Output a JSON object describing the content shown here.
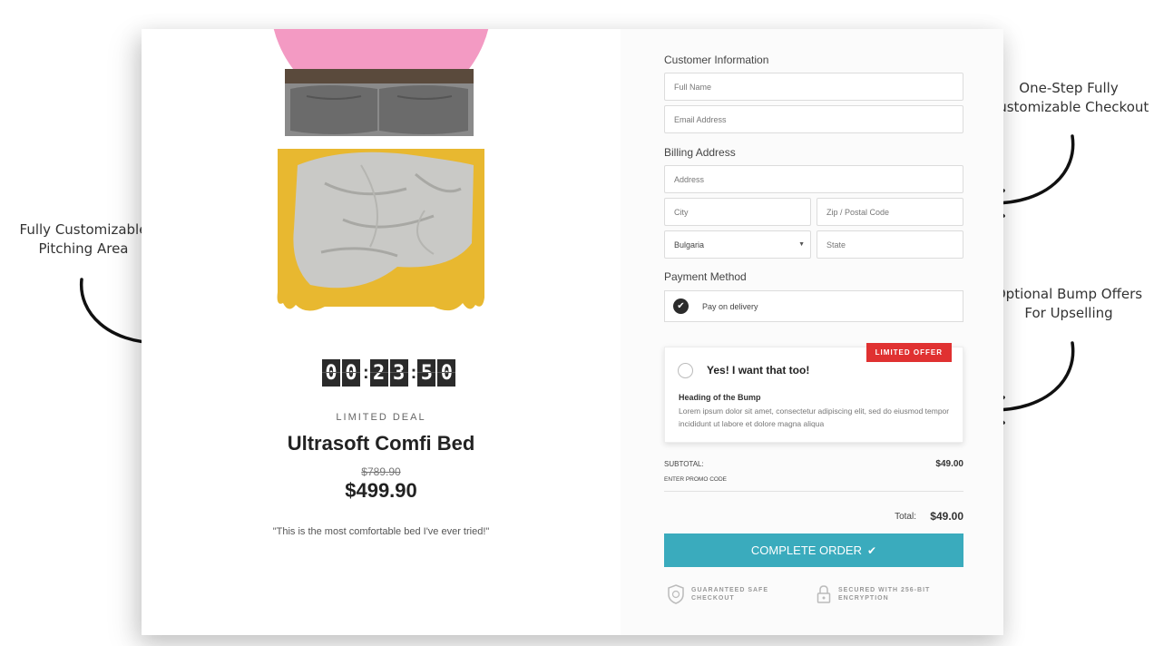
{
  "annotations": {
    "pitching_line1": "Fully Customizable",
    "pitching_line2": "Pitching Area",
    "checkout_line1": "One-Step Fully",
    "checkout_line2": "Customizable Checkout",
    "bump_line1": "Optional Bump Offers",
    "bump_line2": "For Upselling"
  },
  "product": {
    "countdown": [
      "0",
      "0",
      "2",
      "3",
      "5",
      "0"
    ],
    "deal_label": "LIMITED DEAL",
    "title": "Ultrasoft Comfi Bed",
    "old_price": "$789.90",
    "new_price": "$499.90",
    "testimonial": "\"This is the most comfortable bed I've ever tried!\""
  },
  "form": {
    "customer_title": "Customer Information",
    "full_name_placeholder": "Full Name",
    "email_placeholder": "Email Address",
    "billing_title": "Billing Address",
    "address_placeholder": "Address",
    "city_placeholder": "City",
    "zip_placeholder": "Zip / Postal Code",
    "country_value": "Bulgaria",
    "state_placeholder": "State",
    "payment_title": "Payment Method",
    "payment_option": "Pay on delivery"
  },
  "bump": {
    "badge": "LIMITED OFFER",
    "title": "Yes! I want that too!",
    "heading": "Heading of the Bump",
    "text": "Lorem ipsum dolor sit amet, consectetur adipiscing elit, sed do eiusmod tempor incididunt ut labore et dolore magna aliqua"
  },
  "summary": {
    "subtotal_label": "SUBTOTAL:",
    "subtotal_value": "$49.00",
    "promo_label": "ENTER PROMO CODE",
    "total_label": "Total:",
    "total_value": "$49.00",
    "button_label": "COMPLETE ORDER"
  },
  "trust": {
    "safe_line1": "GUARANTEED SAFE",
    "safe_line2": "CHECKOUT",
    "secure_line1": "SECURED WITH 256-BIT",
    "secure_line2": "ENCRYPTION"
  },
  "colors": {
    "accent_button": "#3aabbd",
    "badge_red": "#e03131",
    "blanket_yellow": "#e8b830",
    "pink_circle": "#f39ac3"
  }
}
